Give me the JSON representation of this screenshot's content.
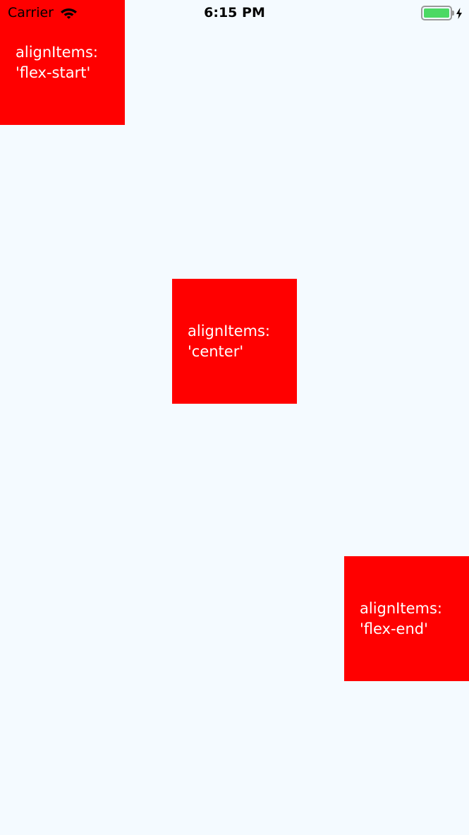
{
  "status_bar": {
    "carrier": "Carrier",
    "time": "6:15 PM",
    "icons": [
      "wifi-icon",
      "battery-icon",
      "charging-bolt-icon"
    ],
    "battery_level": 1.0,
    "battery_color": "#4cd964"
  },
  "boxes": [
    {
      "label": "alignItems:\n'flex-start'"
    },
    {
      "label": "alignItems:\n'center'"
    },
    {
      "label": "alignItems:\n'flex-end'"
    }
  ],
  "colors": {
    "background": "#f4faff",
    "box": "#ff0000",
    "box_text": "#ffffff"
  }
}
